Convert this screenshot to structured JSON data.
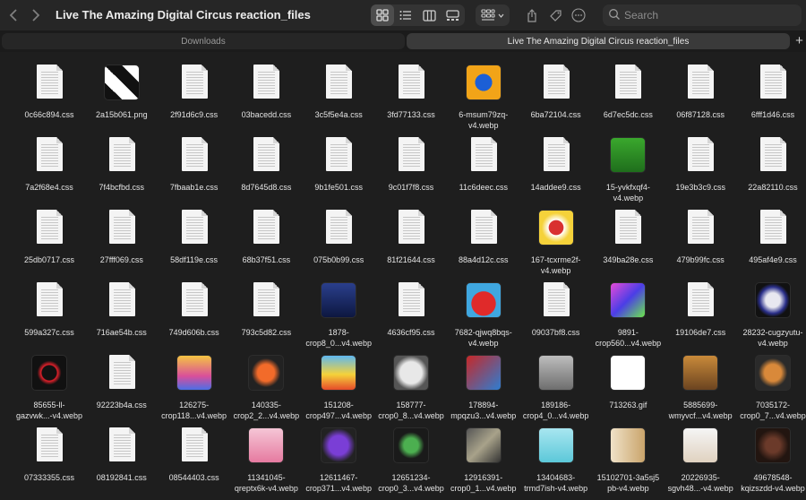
{
  "window": {
    "title": "Live The Amazing Digital Circus reaction_files"
  },
  "toolbar": {
    "back_icon": "chevron-left-icon",
    "forward_icon": "chevron-right-icon",
    "view_modes": [
      "icon-view",
      "list-view",
      "column-view",
      "gallery-view"
    ],
    "active_view": "icon-view",
    "search_placeholder": "Search"
  },
  "tabs": [
    {
      "label": "Downloads",
      "active": false
    },
    {
      "label": "Live The Amazing Digital Circus reaction_files",
      "active": true
    }
  ],
  "files": [
    {
      "name": "0c66c894.css",
      "kind": "doc"
    },
    {
      "name": "2a15b061.png",
      "kind": "img",
      "bg": "linear-gradient(45deg,#111 25%,#fff 25%,#fff 50%,#111 50%,#111 75%,#fff 75%)"
    },
    {
      "name": "2f91d6c9.css",
      "kind": "doc"
    },
    {
      "name": "03bacedd.css",
      "kind": "doc"
    },
    {
      "name": "3c5f5e4a.css",
      "kind": "doc"
    },
    {
      "name": "3fd77133.css",
      "kind": "doc"
    },
    {
      "name": "6-msum79zq-\nv4.webp",
      "kind": "img",
      "bg": "radial-gradient(circle,#1c5fd6 35%,#f2a418 36%)"
    },
    {
      "name": "6ba72104.css",
      "kind": "doc"
    },
    {
      "name": "6d7ec5dc.css",
      "kind": "doc"
    },
    {
      "name": "06f87128.css",
      "kind": "doc"
    },
    {
      "name": "6fff1d46.css",
      "kind": "doc"
    },
    {
      "name": "7a2f68e4.css",
      "kind": "doc"
    },
    {
      "name": "7f4bcfbd.css",
      "kind": "doc"
    },
    {
      "name": "7fbaab1e.css",
      "kind": "doc"
    },
    {
      "name": "8d7645d8.css",
      "kind": "doc"
    },
    {
      "name": "9b1fe501.css",
      "kind": "doc"
    },
    {
      "name": "9c01f7f8.css",
      "kind": "doc"
    },
    {
      "name": "11c6deec.css",
      "kind": "doc"
    },
    {
      "name": "14addee9.css",
      "kind": "doc"
    },
    {
      "name": "15-yvkfxqf4-\nv4.webp",
      "kind": "img",
      "bg": "linear-gradient(#3aa82d,#1f6e1c)"
    },
    {
      "name": "19e3b3c9.css",
      "kind": "doc"
    },
    {
      "name": "22a82110.css",
      "kind": "doc"
    },
    {
      "name": "25db0717.css",
      "kind": "doc"
    },
    {
      "name": "27fff069.css",
      "kind": "doc"
    },
    {
      "name": "58df119e.css",
      "kind": "doc"
    },
    {
      "name": "68b37f51.css",
      "kind": "doc"
    },
    {
      "name": "075b0b99.css",
      "kind": "doc"
    },
    {
      "name": "81f21644.css",
      "kind": "doc"
    },
    {
      "name": "88a4d12c.css",
      "kind": "doc"
    },
    {
      "name": "167-tcxrme2f-\nv4.webp",
      "kind": "img",
      "bg": "radial-gradient(circle,#d93030 30%,#ffffff 32%,#f5d23a 60%)"
    },
    {
      "name": "349ba28e.css",
      "kind": "doc"
    },
    {
      "name": "479b99fc.css",
      "kind": "doc"
    },
    {
      "name": "495af4e9.css",
      "kind": "doc"
    },
    {
      "name": "599a327c.css",
      "kind": "doc"
    },
    {
      "name": "716ae54b.css",
      "kind": "doc"
    },
    {
      "name": "749d606b.css",
      "kind": "doc"
    },
    {
      "name": "793c5d82.css",
      "kind": "doc"
    },
    {
      "name": "1878-\ncrop8_0...v4.webp",
      "kind": "img",
      "bg": "linear-gradient(#2a3f8c,#0d1740)"
    },
    {
      "name": "4636cf95.css",
      "kind": "doc"
    },
    {
      "name": "7682-qjwq8bqs-\nv4.webp",
      "kind": "img",
      "bg": "radial-gradient(circle at 50% 60%,#e02a2a 45%,#3fa7e0 47%)"
    },
    {
      "name": "09037bf8.css",
      "kind": "doc"
    },
    {
      "name": "9891-\ncrop560...v4.webp",
      "kind": "img",
      "bg": "linear-gradient(135deg,#e64bd8,#4b3ee6 50%,#6be64b)"
    },
    {
      "name": "19106de7.css",
      "kind": "doc"
    },
    {
      "name": "28232-cugzyutu-\nv4.webp",
      "kind": "img",
      "bg": "radial-gradient(circle,#e8e8f0 30%,#2a2f8a 55%,#111 70%)"
    },
    {
      "name": "85655-ll-\ngazvwk...-v4.webp",
      "kind": "img",
      "bg": "radial-gradient(circle,#111 30%,#e0202a 34%,#111 50%)"
    },
    {
      "name": "92223b4a.css",
      "kind": "doc"
    },
    {
      "name": "126275-\ncrop118...v4.webp",
      "kind": "img",
      "bg": "linear-gradient(#f5c542,#d94f9a 60%,#4b6ee6)"
    },
    {
      "name": "140335-\ncrop2_2...v4.webp",
      "kind": "img",
      "bg": "radial-gradient(circle,#f26b2a 35%,#222 60%)"
    },
    {
      "name": "151208-\ncrop497...v4.webp",
      "kind": "img",
      "bg": "linear-gradient(#5fb8f0,#f5d23a 55%,#e64b2a)"
    },
    {
      "name": "158777-\ncrop0_8...v4.webp",
      "kind": "img",
      "bg": "radial-gradient(circle,#e8e8e8 45%,#555 70%)"
    },
    {
      "name": "178894-\nmpqzu3...v4.webp",
      "kind": "img",
      "bg": "linear-gradient(135deg,#c62828,#2e7dd1)"
    },
    {
      "name": "189186-\ncrop4_0...v4.webp",
      "kind": "img",
      "bg": "linear-gradient(#bdbdbd,#6e6e6e)"
    },
    {
      "name": "713263.gif",
      "kind": "img",
      "bg": "#ffffff"
    },
    {
      "name": "5885699-\nwmyvcf...v4.webp",
      "kind": "img",
      "bg": "linear-gradient(#c98a3a,#6b4420)"
    },
    {
      "name": "7035172-\ncrop0_7...v4.webp",
      "kind": "img",
      "bg": "radial-gradient(circle,#d9893a 35%,#2a2a2a 60%)"
    },
    {
      "name": "07333355.css",
      "kind": "doc"
    },
    {
      "name": "08192841.css",
      "kind": "doc"
    },
    {
      "name": "08544403.css",
      "kind": "doc"
    },
    {
      "name": "11341045-\nqreptx6k-v4.webp",
      "kind": "img",
      "bg": "linear-gradient(#f5c6d6,#e67aa0)"
    },
    {
      "name": "12611467-\ncrop371...v4.webp",
      "kind": "img",
      "bg": "radial-gradient(circle,#7a3ed6 40%,#222 70%)"
    },
    {
      "name": "12651234-\ncrop0_3...v4.webp",
      "kind": "img",
      "bg": "radial-gradient(circle,#4caf50 30%,#1a1a1a 55%)"
    },
    {
      "name": "12916391-\ncrop0_1...v4.webp",
      "kind": "img",
      "bg": "linear-gradient(135deg,#555,#a8a28a 50%,#333)"
    },
    {
      "name": "13404683-\ntrmd7ish-v4.webp",
      "kind": "img",
      "bg": "linear-gradient(#a8e6f0,#5cc8d9)"
    },
    {
      "name": "15102701-3a5sj5\npb-v4.webp",
      "kind": "img",
      "bg": "linear-gradient(90deg,#f0e2c8,#c9a46b)"
    },
    {
      "name": "20226935-\nsgvh48...-v4.webp",
      "kind": "img",
      "bg": "linear-gradient(#f5f5f5,#e0d2c0)"
    },
    {
      "name": "49678548-\nkqizszdd-v4.webp",
      "kind": "img",
      "bg": "radial-gradient(circle,#6b3a2a 30%,#221510 65%)"
    }
  ]
}
